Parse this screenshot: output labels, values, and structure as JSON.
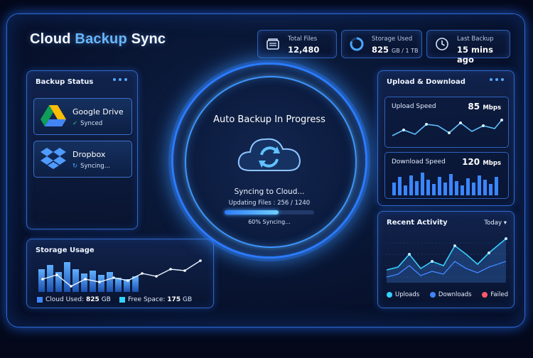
{
  "app": {
    "title_main": "Cloud ",
    "title_accent": "Backup",
    "title_tail": " Sync"
  },
  "stats": {
    "total_files_label": "Total Files",
    "total_files_value": "12,480",
    "storage_label": "Storage Used",
    "storage_value": "825",
    "storage_unit": "GB / 1 TB",
    "last_backup_label": "Last Backup",
    "last_backup_value": "15 mins ago"
  },
  "backup_status": {
    "title": "Backup Status",
    "services": [
      {
        "name": "Google Drive",
        "status": "Synced",
        "icon": "google-drive-icon"
      },
      {
        "name": "Dropbox",
        "status": "Syncing...",
        "icon": "dropbox-icon"
      }
    ]
  },
  "center": {
    "heading": "Auto Backup In Progress",
    "sync_text": "Syncing to Cloud...",
    "files_text": "Updating Files : 256  /  1240",
    "progress_fraction": 0.6,
    "progress_text": "60% Syncing..."
  },
  "upload_download": {
    "title": "Upload & Download",
    "upload_label": "Upload Speed",
    "upload_value": "85",
    "upload_unit": "Mbps",
    "download_label": "Download Speed",
    "download_value": "120",
    "download_unit": "Mbps"
  },
  "storage_usage": {
    "title": "Storage Usage",
    "cloud_used_label": "Cloud Used:",
    "cloud_used_value": "825",
    "cloud_used_unit": "GB",
    "free_space_label": "Free Space:",
    "free_space_value": "175",
    "free_space_unit": "GB"
  },
  "recent_activity": {
    "title": "Recent Activity",
    "range": "Today",
    "legend": [
      {
        "label": "Uploads",
        "color": "#35d2ff"
      },
      {
        "label": "Downloads",
        "color": "#3f86ff"
      },
      {
        "label": "Failed",
        "color": "#ff5a6a"
      }
    ]
  },
  "colors": {
    "accent": "#3f8cff",
    "cyan": "#35d2ff",
    "success": "#38d17c"
  }
}
